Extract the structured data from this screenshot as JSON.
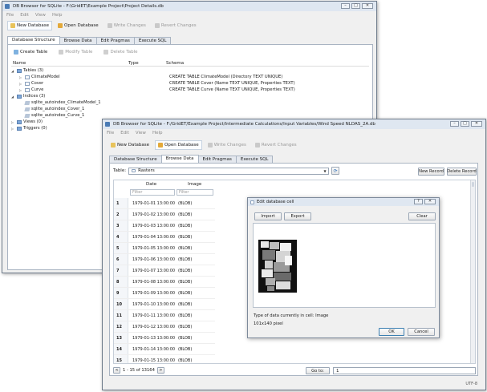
{
  "back_window": {
    "title": "DB Browser for SQLite - F:\\GridET\\Example Project\\Project Details.db",
    "menu": [
      "File",
      "Edit",
      "View",
      "Help"
    ],
    "toolbar": {
      "new_database": "New Database",
      "open_database": "Open Database",
      "write_changes": "Write Changes",
      "revert_changes": "Revert Changes"
    },
    "tabs": [
      "Database Structure",
      "Browse Data",
      "Edit Pragmas",
      "Execute SQL"
    ],
    "structure_toolbar": {
      "create_table": "Create Table",
      "modify_table": "Modify Table",
      "delete_table": "Delete Table"
    },
    "columns": {
      "name": "Name",
      "type": "Type",
      "schema": "Schema"
    },
    "tree": [
      {
        "name": "Tables (3)",
        "schema": "",
        "level": 0,
        "kind": "folder",
        "expanded": true
      },
      {
        "name": "ClimateModel",
        "schema": "CREATE TABLE ClimateModel (Directory TEXT UNIQUE)",
        "level": 1,
        "kind": "table"
      },
      {
        "name": "Cover",
        "schema": "CREATE TABLE Cover (Name TEXT UNIQUE, Properties TEXT)",
        "level": 1,
        "kind": "table"
      },
      {
        "name": "Curve",
        "schema": "CREATE TABLE Curve (Name TEXT UNIQUE, Properties TEXT)",
        "level": 1,
        "kind": "table"
      },
      {
        "name": "Indices (3)",
        "schema": "",
        "level": 0,
        "kind": "folder",
        "expanded": true
      },
      {
        "name": "sqlite_autoindex_ClimateModel_1",
        "schema": "",
        "level": 1,
        "kind": "index"
      },
      {
        "name": "sqlite_autoindex_Cover_1",
        "schema": "",
        "level": 1,
        "kind": "index"
      },
      {
        "name": "sqlite_autoindex_Curve_1",
        "schema": "",
        "level": 1,
        "kind": "index"
      },
      {
        "name": "Views (0)",
        "schema": "",
        "level": 0,
        "kind": "folder",
        "expanded": false
      },
      {
        "name": "Triggers (0)",
        "schema": "",
        "level": 0,
        "kind": "folder",
        "expanded": false
      }
    ]
  },
  "front_window": {
    "title": "DB Browser for SQLite - F:/GridET/Example Project/Intermediate Calculations/Input Variables/Wind Speed NLDAS_2A.db",
    "menu": [
      "File",
      "Edit",
      "View",
      "Help"
    ],
    "toolbar": {
      "new_database": "New Database",
      "open_database": "Open Database",
      "write_changes": "Write Changes",
      "revert_changes": "Revert Changes"
    },
    "tabs": [
      "Database Structure",
      "Browse Data",
      "Edit Pragmas",
      "Execute SQL"
    ],
    "browse": {
      "table_label": "Table:",
      "table_value": "Rasters",
      "new_record": "New Record",
      "delete_record": "Delete Record",
      "columns": [
        "Date",
        "Image"
      ],
      "filter_placeholder": "Filter",
      "rows": [
        {
          "n": "1",
          "date": "1979-01-01 13:00:00",
          "image": "(BLOB)"
        },
        {
          "n": "2",
          "date": "1979-01-02 13:00:00",
          "image": "(BLOB)"
        },
        {
          "n": "3",
          "date": "1979-01-03 13:00:00",
          "image": "(BLOB)"
        },
        {
          "n": "4",
          "date": "1979-01-04 13:00:00",
          "image": "(BLOB)"
        },
        {
          "n": "5",
          "date": "1979-01-05 13:00:00",
          "image": "(BLOB)"
        },
        {
          "n": "6",
          "date": "1979-01-06 13:00:00",
          "image": "(BLOB)"
        },
        {
          "n": "7",
          "date": "1979-01-07 13:00:00",
          "image": "(BLOB)"
        },
        {
          "n": "8",
          "date": "1979-01-08 13:00:00",
          "image": "(BLOB)"
        },
        {
          "n": "9",
          "date": "1979-01-09 13:00:00",
          "image": "(BLOB)"
        },
        {
          "n": "10",
          "date": "1979-01-10 13:00:00",
          "image": "(BLOB)"
        },
        {
          "n": "11",
          "date": "1979-01-11 13:00:00",
          "image": "(BLOB)"
        },
        {
          "n": "12",
          "date": "1979-01-12 13:00:00",
          "image": "(BLOB)"
        },
        {
          "n": "13",
          "date": "1979-01-13 13:00:00",
          "image": "(BLOB)"
        },
        {
          "n": "14",
          "date": "1979-01-14 13:00:00",
          "image": "(BLOB)"
        },
        {
          "n": "15",
          "date": "1979-01-15 13:00:00",
          "image": "(BLOB)"
        }
      ],
      "pager_prev": "<",
      "pager_text": "1 - 15 of 13164",
      "pager_next": ">",
      "goto_label": "Go to:",
      "goto_value": "1"
    },
    "status_encoding": "UTF-8"
  },
  "edit_cell_dialog": {
    "title": "Edit database cell",
    "import": "Import",
    "export": "Export",
    "clear": "Clear",
    "type_info": "Type of data currently in cell: Image",
    "size_info": "101x140 pixel",
    "ok": "OK",
    "cancel": "Cancel"
  },
  "colors": {
    "titlebar": "#dfe7f1",
    "window_bg": "#f0f0f0",
    "folder_icon": "#7fa7d8"
  }
}
